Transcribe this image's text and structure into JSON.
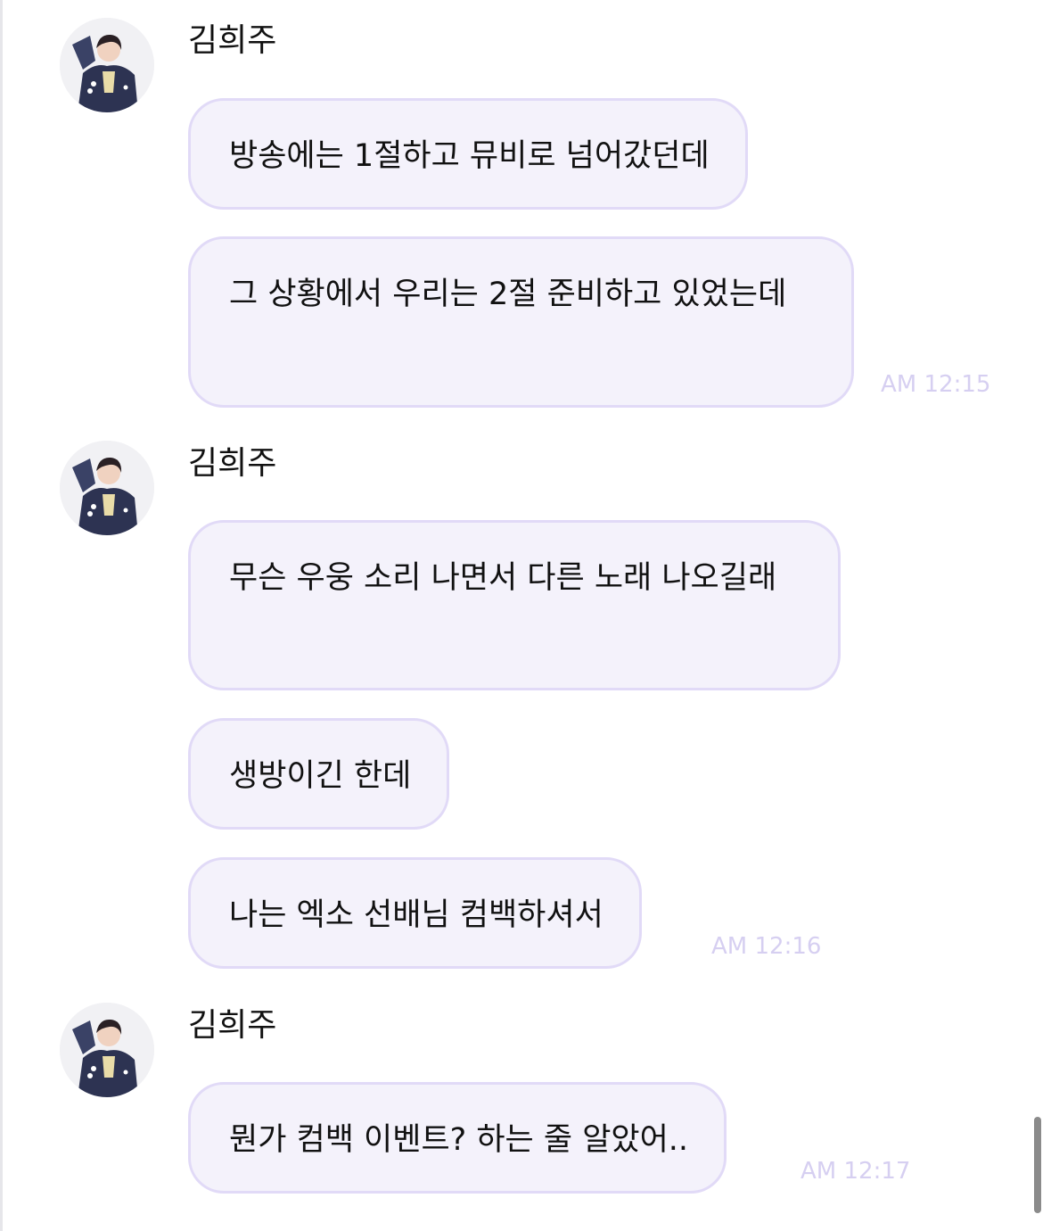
{
  "colors": {
    "bubble_background": "#f4f2fb",
    "bubble_border": "#e1daf7",
    "timestamp": "#d6cff1"
  },
  "groups": [
    {
      "sender": "김희주",
      "avatar_icon": "profile-photo",
      "messages": [
        "방송에는 1절하고 뮤비로 넘어갔던데",
        "그 상황에서 우리는 2절 준비하고 있었는데"
      ],
      "time": "AM 12:15"
    },
    {
      "sender": "김희주",
      "avatar_icon": "profile-photo",
      "messages": [
        "무슨 우웅 소리 나면서 다른 노래 나오길래",
        "생방이긴 한데",
        "나는 엑소 선배님 컴백하셔서"
      ],
      "time": "AM 12:16"
    },
    {
      "sender": "김희주",
      "avatar_icon": "profile-photo",
      "messages": [
        "뭔가 컴백 이벤트? 하는 줄 알았어.."
      ],
      "time": "AM 12:17"
    }
  ]
}
